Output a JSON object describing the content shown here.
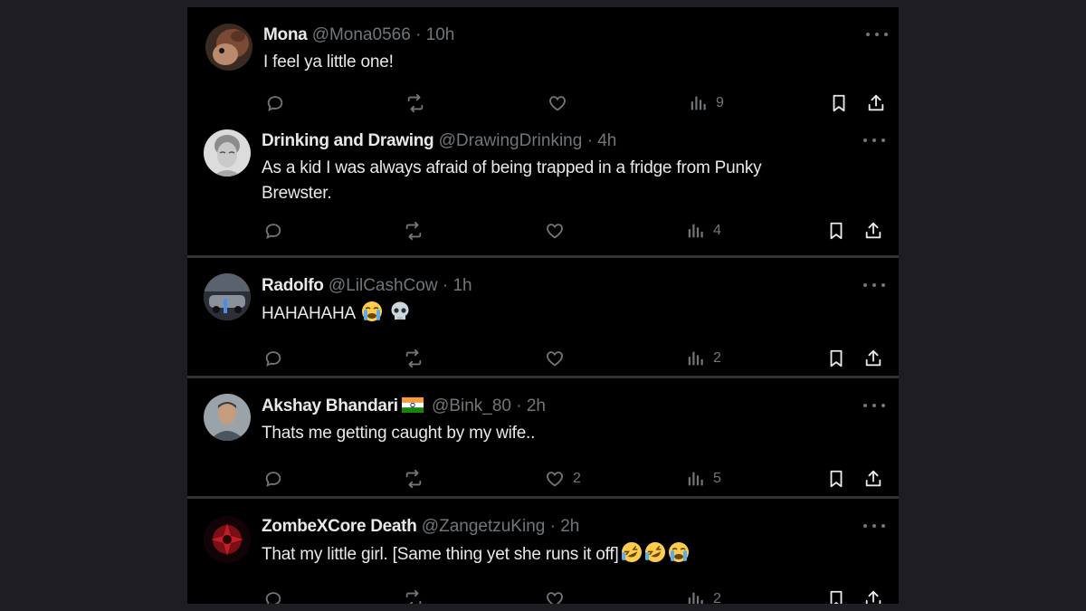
{
  "colors": {
    "background": "#000000",
    "text": "#e7e9ea",
    "muted": "#71767b",
    "separator": "#2f3336"
  },
  "icons": {
    "reply": "reply-icon",
    "repost": "repost-icon",
    "like": "like-icon",
    "views": "views-icon",
    "bookmark": "bookmark-icon",
    "share": "share-icon",
    "more": "more-icon"
  },
  "tweets": [
    {
      "name": "Mona",
      "handle": "@Mona0566",
      "dot": "·",
      "time": "10h",
      "text": "I feel ya little one!",
      "likes": "",
      "views": "9"
    },
    {
      "name": "Drinking and Drawing",
      "handle": "@DrawingDrinking",
      "dot": "·",
      "time": "4h",
      "text": "As a kid I was always afraid of being trapped in a fridge from Punky Brewster.",
      "likes": "",
      "views": "4"
    },
    {
      "name": "Radolfo",
      "handle": "@LilCashCow",
      "dot": "·",
      "time": "1h",
      "text": "HAHAHAHA",
      "likes": "",
      "views": "2"
    },
    {
      "name": "Akshay Bhandari",
      "handle": "@Bink_80",
      "dot": "·",
      "time": "2h",
      "text": "Thats me getting caught by my wife..",
      "likes": "2",
      "views": "5"
    },
    {
      "name": "ZombeXCore Death",
      "handle": "@ZangetzuKing",
      "dot": "·",
      "time": "2h",
      "text": "That my little girl. [Same thing yet she runs it off]",
      "likes": "",
      "views": "2"
    }
  ]
}
